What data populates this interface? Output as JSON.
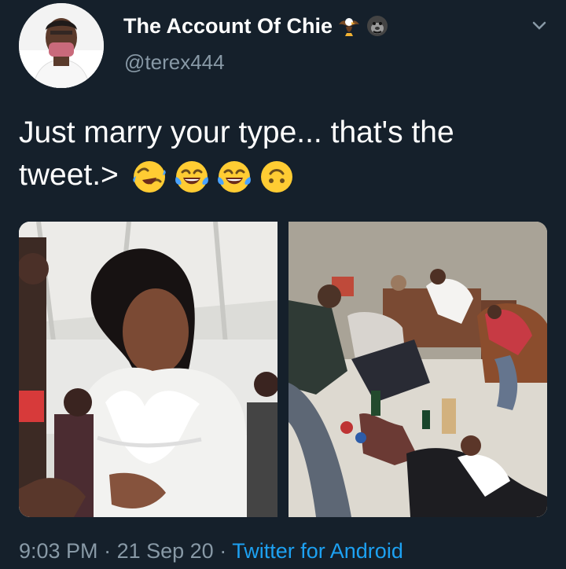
{
  "tweet": {
    "display_name": "The Account Of Chie",
    "handle": "@terex444",
    "text": "Just marry your type... that's the tweet.>",
    "badges": [
      "eagle-emoji",
      "gorilla-emoji"
    ],
    "emojis": [
      "rolling-on-floor-laughing-emoji",
      "tears-of-joy-emoji",
      "tears-of-joy-emoji",
      "upside-down-face-emoji"
    ],
    "time": "9:03 PM",
    "separator": "·",
    "date": "21 Sep 20",
    "source": "Twitter for Android"
  },
  "colors": {
    "background": "#15202b",
    "secondary_text": "#8899a6",
    "link": "#1da1f2"
  }
}
